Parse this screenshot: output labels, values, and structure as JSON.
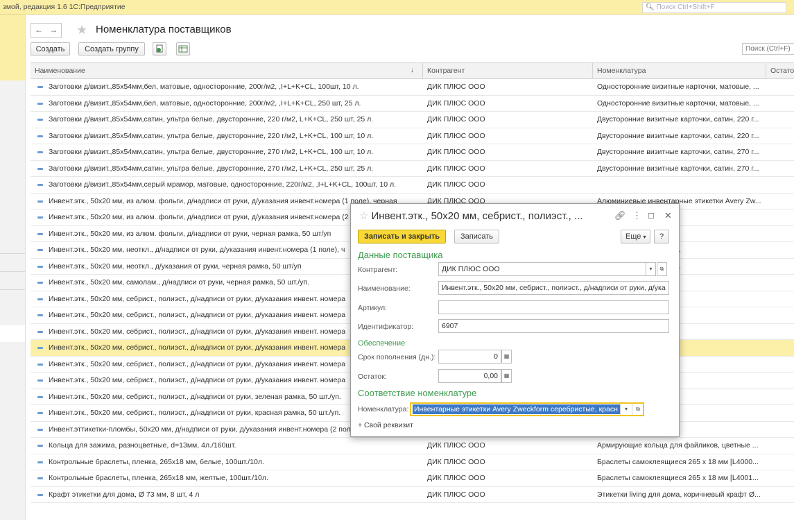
{
  "topbar": {
    "title": "змой, редакция 1.6 1С:Предприятие",
    "search_placeholder": "Поиск Ctrl+Shift+F"
  },
  "form": {
    "title": "Номенклатура поставщиков",
    "back": "←",
    "forward": "→",
    "create_label": "Создать",
    "create_group_label": "Создать группу",
    "search_placeholder": "Поиск (Ctrl+F)"
  },
  "table": {
    "columns": [
      "Наименование",
      "Контрагент",
      "Номенклатура",
      "Остаток"
    ],
    "sort_marker": "↓",
    "rows": [
      {
        "name": "Заготовки д/визит.,85x54мм,бел, матовые, односторонние, 200г/м2, ,I+L+K+CL, 100шт, 10 л.",
        "agent": "ДИК ПЛЮС ООО",
        "nom": "Односторонние визитные карточки, матовые, ..."
      },
      {
        "name": "Заготовки д/визит.,85x54мм,бел, матовые, односторонние, 200г/м2, ,I+L+K+CL, 250 шт, 25 л.",
        "agent": "ДИК ПЛЮС ООО",
        "nom": "Односторонние визитные карточки, матовые, ..."
      },
      {
        "name": "Заготовки д/визит.,85x54мм,сатин, ультра белые, двусторонние, 220 г/м2,  L+K+CL, 250 шт, 25 л.",
        "agent": "ДИК ПЛЮС ООО",
        "nom": "Двусторонние визитные карточки, сатин, 220 г..."
      },
      {
        "name": "Заготовки д/визит.,85x54мм,сатин, ультра белые, двусторонние, 220 г/м2, L+K+CL, 100 шт, 10 л.",
        "agent": "ДИК ПЛЮС ООО",
        "nom": "Двусторонние визитные карточки, сатин, 220 г..."
      },
      {
        "name": "Заготовки д/визит.,85x54мм,сатин, ультра белые, двусторонние, 270 г/м2,  L+K+CL, 100 шт, 10 л.",
        "agent": "ДИК ПЛЮС ООО",
        "nom": "Двусторонние визитные карточки, сатин, 270 г..."
      },
      {
        "name": "Заготовки д/визит.,85x54мм,сатин, ультра белые, двусторонние, 270 г/м2,  L+K+CL, 250 шт, 25 л.",
        "agent": "ДИК ПЛЮС ООО",
        "nom": "Двусторонние визитные карточки, сатин, 270 г..."
      },
      {
        "name": "Заготовки д/визит.,85x54мм,серый мрамор, матовые, односторонние, 220г/м2, ,I+L+K+CL, 100шт, 10 л.",
        "agent": "ДИК ПЛЮС ООО",
        "nom": ""
      },
      {
        "name": "Инвент.этк., 50x20 мм, из алюм. фольги, д/надписи от руки, д/указания инвент.номера (1 поле), черная",
        "agent": "ДИК ПЛЮС ООО",
        "nom": "Алюминиевые инвентарные этикетки Avery Zw..."
      },
      {
        "name": "Инвент.этк., 50x20 мм, из алюм. фольги, д/надписи от руки, д/указания инвент.номера (2",
        "agent": "",
        "nom": "ные этикетки Avery Zw..."
      },
      {
        "name": "Инвент.этк., 50x20 мм, из алюм. фольги, д/надписи от руки, черная рамка, 50 шт/уп",
        "agent": "",
        "nom": "ные этикетки Avery Zw..."
      },
      {
        "name": "Инвент.этк., 50x20 мм, неоткл., д/надписи от руки, д/указания инвент.номера (1 поле), ч",
        "agent": "",
        "nom": "ентарные этикетки Ave..."
      },
      {
        "name": "Инвент.этк., 50x20 мм, неоткл., д/указания от руки, черная рамка, 50 шт/уп",
        "agent": "",
        "nom": "ентарные этикетки Ave..."
      },
      {
        "name": "Инвент.этк., 50x20 мм, самолам., д/надписи от руки, черная рамка, 50 шт./уп.",
        "agent": "",
        "nom": "инвентарные этикетки ..."
      },
      {
        "name": "Инвент.этк., 50x20 мм, себрист., полиэст., д/надписи от руки, д/указания инвент. номера",
        "agent": "",
        "nom": "ery Zweckform сереб..."
      },
      {
        "name": "Инвент.этк., 50x20 мм, себрист., полиэст., д/надписи от руки, д/указания инвент. номера",
        "agent": "",
        "nom": "ery Zweckform сереб..."
      },
      {
        "name": "Инвент.этк., 50x20 мм, себрист., полиэст., д/надписи от руки, д/указания инвент. номера",
        "agent": "",
        "nom": "ery Zweckform сереб..."
      },
      {
        "name": "Инвент.этк., 50x20 мм, себрист., полиэст., д/надписи от руки, д/указания инвент. номера",
        "agent": "",
        "nom": "ery Zweckform сереб..."
      },
      {
        "name": "Инвент.этк., 50x20 мм, себрист., полиэст., д/надписи от руки, д/указания инвент. номера",
        "agent": "",
        "nom": "ery Zweckform сереб..."
      },
      {
        "name": "Инвент.этк., 50x20 мм, себрист., полиэст., д/надписи от руки, д/указания инвент. номера",
        "agent": "",
        "nom": "ery Zweckform сереб..."
      },
      {
        "name": "Инвент.этк., 50x20 мм, себрист., полиэст., д/надписи от руки, зеленая рамка, 50 шт./уп.",
        "agent": "",
        "nom": "ery Zweckform сереб..."
      },
      {
        "name": "Инвент.этк., 50x20 мм, себрист., полиэст., д/надписи от руки, красная рамка, 50 шт./уп.",
        "agent": "",
        "nom": "ery Zweckform сереб..."
      },
      {
        "name": "Инвент.эттикетки-пломбы, 50x20 мм, д/надписи от руки, д/указания инвент.номера (2 пол",
        "agent": "",
        "nom": "ломбы, синяя рамка 5..."
      },
      {
        "name": "Кольца для зажима, разноцветные, d=13мм, 4л./160шт.",
        "agent": "ДИК ПЛЮС ООО",
        "nom": "Армирующие кольца для файликов, цветные ..."
      },
      {
        "name": "Контрольные браслеты, пленка, 265x18 мм, белые, 100шт./10л.",
        "agent": "ДИК ПЛЮС ООО",
        "nom": "Браслеты самоклеящиеся 265 x 18 мм [L4000..."
      },
      {
        "name": "Контрольные браслеты, пленка, 265x18 мм, желтые, 100шт./10л.",
        "agent": "ДИК ПЛЮС ООО",
        "nom": "Браслеты самоклеящиеся 265 x 18 мм [L4001..."
      },
      {
        "name": "Крафт этикетки для дома, Ø 73 мм, 8 шт, 4 л",
        "agent": "ДИК ПЛЮС ООО",
        "nom": "Этикетки living для дома, коричневый крафт Ø..."
      }
    ]
  },
  "modal": {
    "title": "Инвент.этк., 50x20 мм, себрист., полиэст., ...",
    "save_close_label": "Записать и закрыть",
    "save_label": "Записать",
    "more_label": "Еще",
    "help_label": "?",
    "section_supplier": "Данные поставщика",
    "label_agent": "Контрагент:",
    "value_agent": "ДИК ПЛЮС ООО",
    "label_name": "Наименование:",
    "value_name": "Инвент.этк., 50x20 мм, себрист., полиэст., д/надписи от руки, д/ука",
    "label_article": "Артикул:",
    "value_article": "",
    "label_id": "Идентификатор:",
    "value_id": "6907",
    "subsection_supply": "Обеспечение",
    "label_lead": "Срок пополнения (дн.):",
    "value_lead": "0",
    "label_rest": "Остаток:",
    "value_rest": "0,00",
    "section_match": "Соответствие номенклатуре",
    "label_nom": "Номенклатура:",
    "value_nom": "Инвентарные этикетки Avery Zweckform серебристые, красн",
    "add_attr_label": "+ Свой реквизит"
  },
  "colors": {
    "accent_yellow": "#f8d838",
    "selection": "#fcefa8",
    "section_green": "#3c9b4e"
  }
}
